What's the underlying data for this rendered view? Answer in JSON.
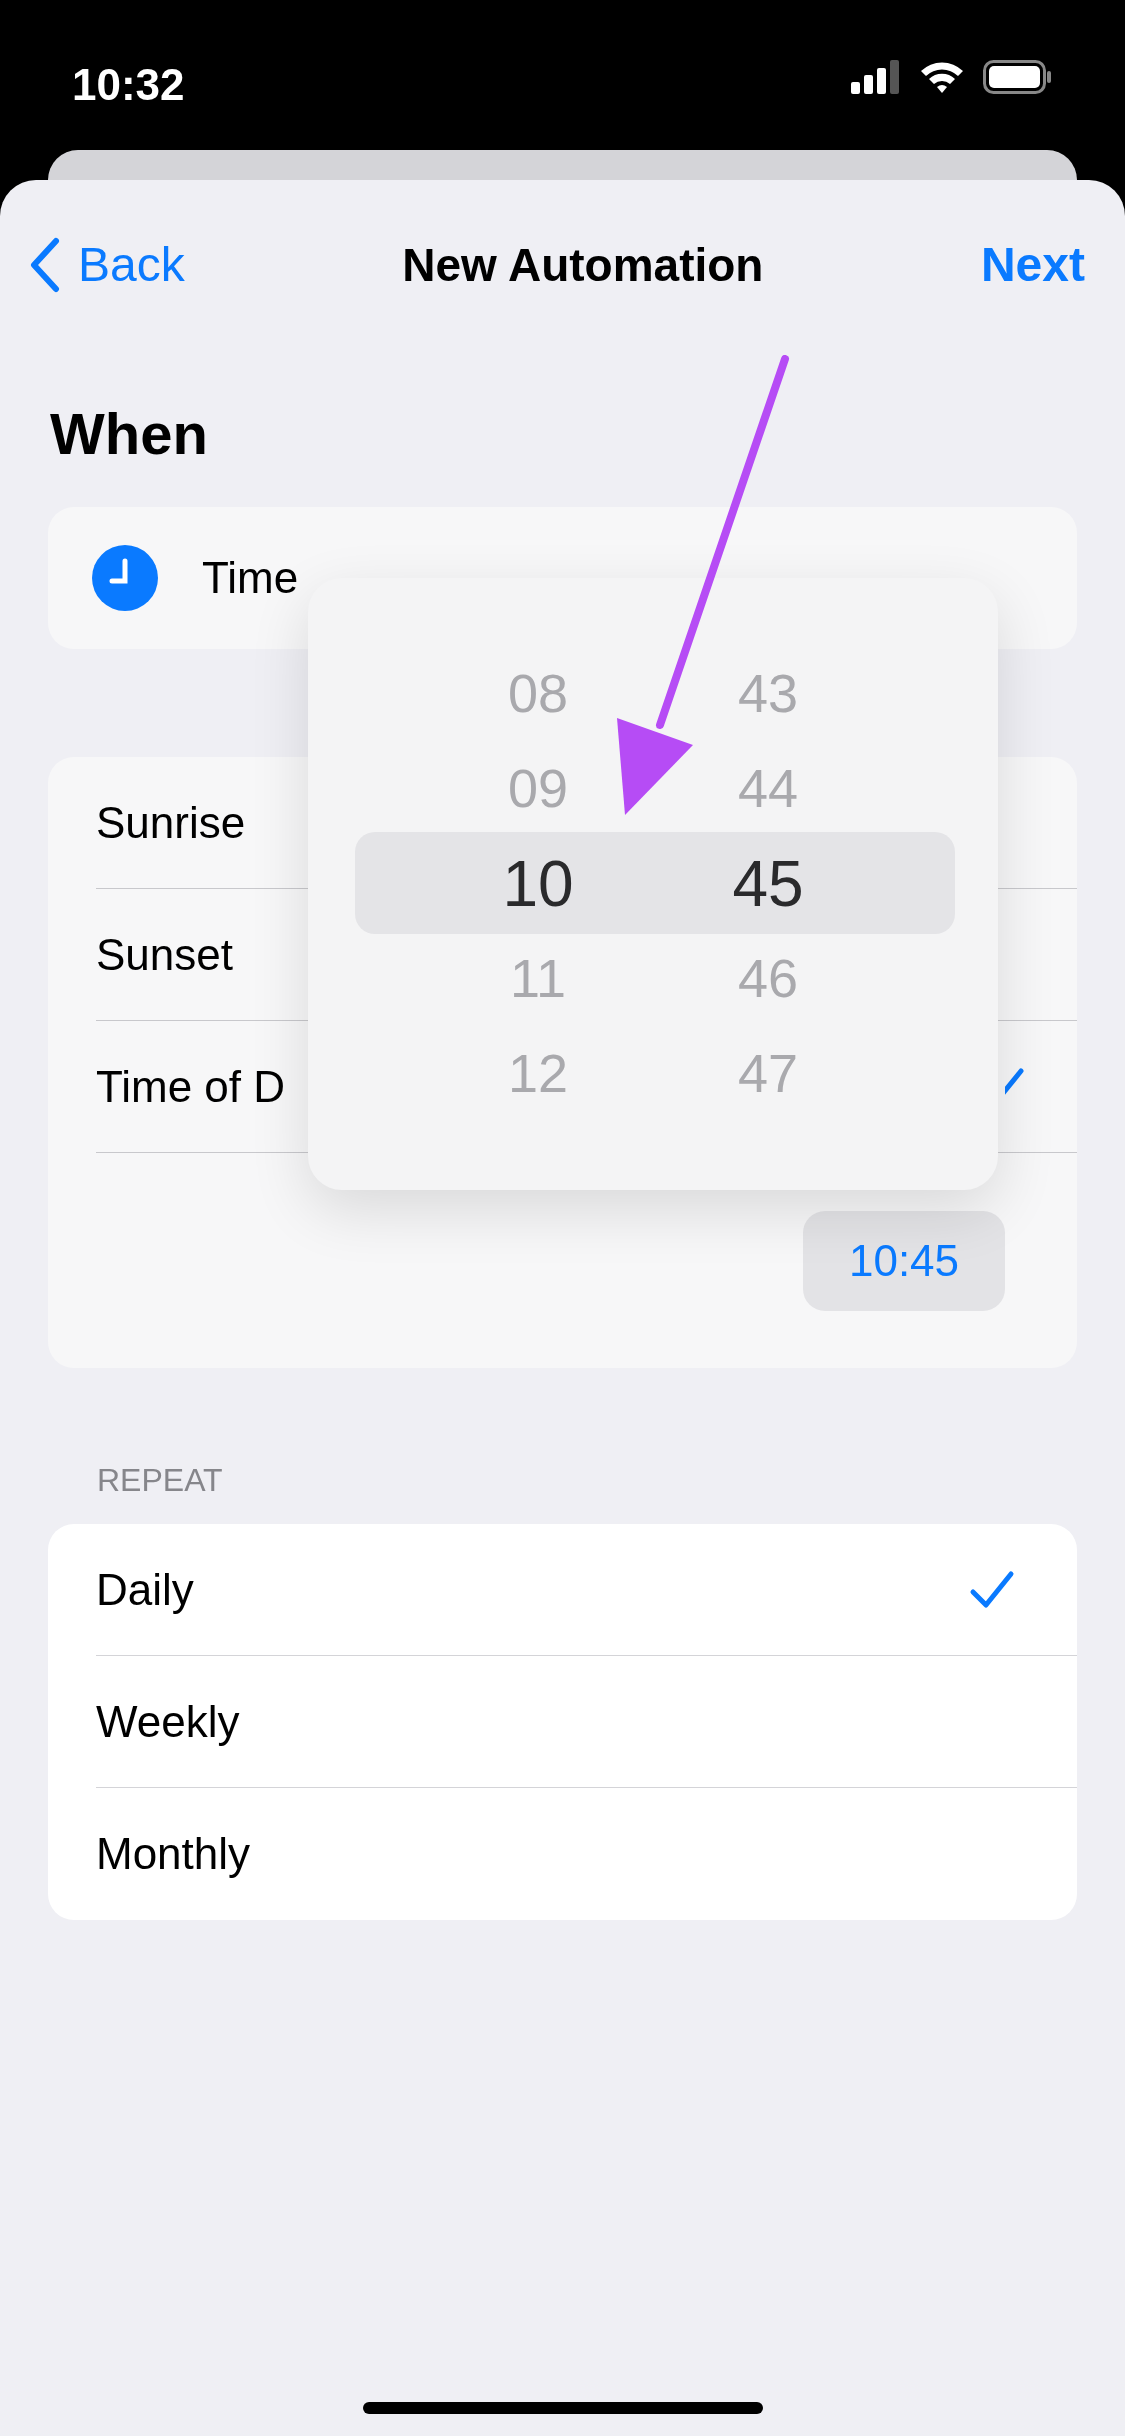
{
  "status_bar": {
    "time": "10:32"
  },
  "nav": {
    "back": "Back",
    "title": "New Automation",
    "next": "Next"
  },
  "section_title": "When",
  "trigger": {
    "label": "Time"
  },
  "options": [
    {
      "label": "Sunrise",
      "selected": false
    },
    {
      "label": "Sunset",
      "selected": false
    },
    {
      "label": "Time of D",
      "selected": true
    }
  ],
  "time_value": "10:45",
  "repeat": {
    "header": "REPEAT",
    "items": [
      {
        "label": "Daily",
        "selected": true
      },
      {
        "label": "Weekly",
        "selected": false
      },
      {
        "label": "Monthly",
        "selected": false
      }
    ]
  },
  "picker": {
    "hours": [
      {
        "label": "08",
        "selected": false
      },
      {
        "label": "09",
        "selected": false
      },
      {
        "label": "10",
        "selected": true
      },
      {
        "label": "11",
        "selected": false
      },
      {
        "label": "12",
        "selected": false
      }
    ],
    "minutes": [
      {
        "label": "43",
        "selected": false
      },
      {
        "label": "44",
        "selected": false
      },
      {
        "label": "45",
        "selected": true
      },
      {
        "label": "46",
        "selected": false
      },
      {
        "label": "47",
        "selected": false
      }
    ]
  }
}
